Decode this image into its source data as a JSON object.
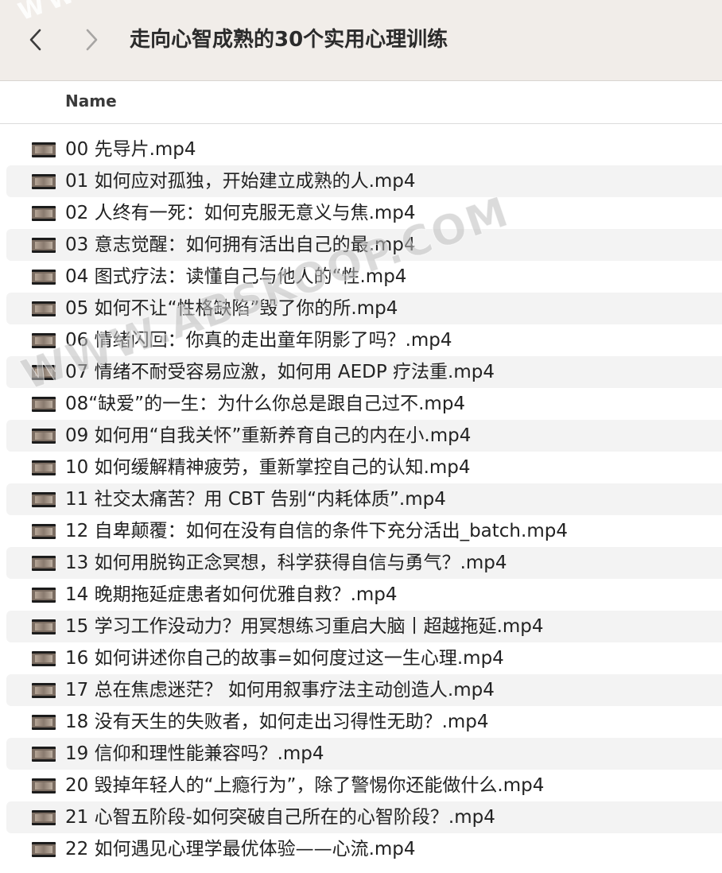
{
  "window": {
    "title": "走向心智成熟的30个实用心理训练"
  },
  "toolbar": {
    "back_icon": "chevron-left-icon",
    "forward_icon": "chevron-right-icon"
  },
  "columns": {
    "name": "Name"
  },
  "watermark": {
    "top": "WW",
    "diagonal": "WWW.ABSKOOP.COM"
  },
  "files": [
    "00 先导片.mp4",
    "01 如何应对孤独，开始建立成熟的人.mp4",
    "02 人终有一死：如何克服无意义与焦.mp4",
    "03 意志觉醒：如何拥有活出自己的最.mp4",
    "04 图式疗法：读懂自己与他人的“性.mp4",
    "05 如何不让“性格缺陷”毁了你的所.mp4",
    "06 情绪闪回：你真的走出童年阴影了吗？.mp4",
    "07 情绪不耐受容易应激，如何用 AEDP 疗法重.mp4",
    "08“缺爱”的一生：为什么你总是跟自己过不.mp4",
    "09 如何用“自我关怀”重新养育自己的内在小.mp4",
    "10 如何缓解精神疲劳，重新掌控自己的认知.mp4",
    "11 社交太痛苦？用 CBT 告别“内耗体质”.mp4",
    "12 自卑颠覆：如何在没有自信的条件下充分活出_batch.mp4",
    "13 如何用脱钩正念冥想，科学获得自信与勇气？.mp4",
    "14 晚期拖延症患者如何优雅自救？.mp4",
    "15 学习工作没动力？用冥想练习重启大脑丨超越拖延.mp4",
    "16 如何讲述你自己的故事=如何度过这一生心理.mp4",
    "17 总在焦虑迷茫？ 如何用叙事疗法主动创造人.mp4",
    "18 没有天生的失败者，如何走出习得性无助？.mp4",
    "19 信仰和理性能兼容吗？.mp4",
    "20 毁掉年轻人的“上瘾行为”，除了警惕你还能做什么.mp4",
    "21 心智五阶段-如何突破自己所在的心智阶段？.mp4",
    "22 如何遇见心理学最优体验——心流.mp4"
  ],
  "file_icon": "video-thumbnail-icon"
}
